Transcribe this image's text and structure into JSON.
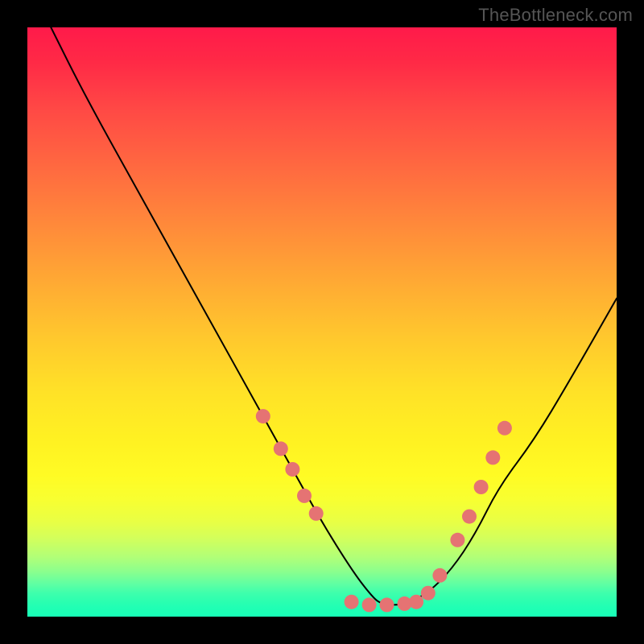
{
  "attribution": "TheBottleneck.com",
  "chart_data": {
    "type": "line",
    "title": "",
    "xlabel": "",
    "ylabel": "",
    "xlim": [
      0,
      100
    ],
    "ylim": [
      0,
      100
    ],
    "series": [
      {
        "name": "bottleneck-curve",
        "x": [
          4,
          10,
          20,
          30,
          40,
          45,
          50,
          55,
          58,
          60,
          64,
          68,
          72,
          76,
          80,
          86,
          92,
          100
        ],
        "y": [
          100,
          88,
          70,
          52,
          34,
          25,
          16,
          8,
          4,
          2,
          2,
          4,
          8,
          14,
          22,
          30,
          40,
          54
        ]
      }
    ],
    "markers": {
      "name": "highlight-dots",
      "color": "#e57373",
      "points": [
        {
          "x": 40,
          "y": 34
        },
        {
          "x": 43,
          "y": 28.5
        },
        {
          "x": 45,
          "y": 25
        },
        {
          "x": 47,
          "y": 20.5
        },
        {
          "x": 49,
          "y": 17.5
        },
        {
          "x": 55,
          "y": 2.5
        },
        {
          "x": 58,
          "y": 2
        },
        {
          "x": 61,
          "y": 2
        },
        {
          "x": 64,
          "y": 2.2
        },
        {
          "x": 66,
          "y": 2.5
        },
        {
          "x": 68,
          "y": 4
        },
        {
          "x": 70,
          "y": 7
        },
        {
          "x": 73,
          "y": 13
        },
        {
          "x": 75,
          "y": 17
        },
        {
          "x": 77,
          "y": 22
        },
        {
          "x": 79,
          "y": 27
        },
        {
          "x": 81,
          "y": 32
        }
      ]
    },
    "background_gradient": {
      "top_color": "#ff1a4a",
      "bottom_color": "#18ffb6",
      "description": "vertical red-yellow-green spectrum"
    }
  }
}
